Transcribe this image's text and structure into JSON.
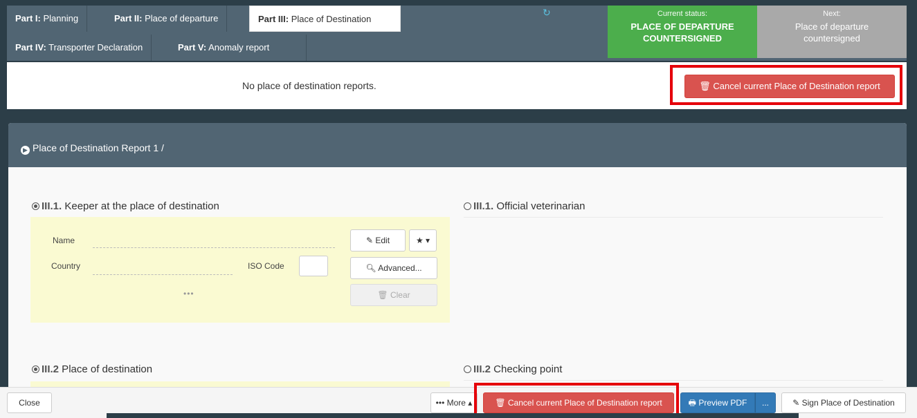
{
  "tabs": [
    {
      "strong": "Part I:",
      "rest": " Planning"
    },
    {
      "strong": "Part II:",
      "rest": " Place of departure"
    },
    {
      "strong": "Part III:",
      "rest": " Place of Destination"
    },
    {
      "strong": "Part IV:",
      "rest": " Transporter Declaration"
    },
    {
      "strong": "Part V:",
      "rest": " Anomaly report"
    }
  ],
  "status": {
    "current_label": "Current status:",
    "current_value_line1": "PLACE OF DEPARTURE",
    "current_value_line2": "COUNTERSIGNED",
    "next_label": "Next:",
    "next_value_line1": "Place of departure",
    "next_value_line2": "countersigned"
  },
  "reports": {
    "empty_text": "No place of destination reports.",
    "cancel_label": "Cancel current Place of Destination report"
  },
  "panel": {
    "title": "Place of Destination Report 1 /",
    "keeper": {
      "num": "III.1.",
      "title": " Keeper at the place of destination"
    },
    "vet": {
      "num": "III.1.",
      "title": " Official veterinarian"
    },
    "dest": {
      "num": "III.2",
      "title": " Place of destination"
    },
    "check": {
      "num": "III.2",
      "title": " Checking point"
    },
    "fields": {
      "name": "Name",
      "country": "Country",
      "iso": "ISO Code",
      "more": "•••"
    },
    "buttons": {
      "edit": "Edit",
      "favorite": "★ ▾",
      "advanced": "Advanced...",
      "clear": "Clear"
    }
  },
  "footer": {
    "close": "Close",
    "more": "••• More ▴",
    "cancel": "Cancel current Place of Destination report",
    "preview": "Preview PDF",
    "preview_more": "...",
    "sign": "Sign Place of Destination"
  },
  "colors": {
    "accent": "#337ab7",
    "danger": "#d9534f",
    "status_current": "#4cae4c",
    "status_next": "#a9a9a9",
    "header": "#516573",
    "highlight": "#e5000a"
  }
}
